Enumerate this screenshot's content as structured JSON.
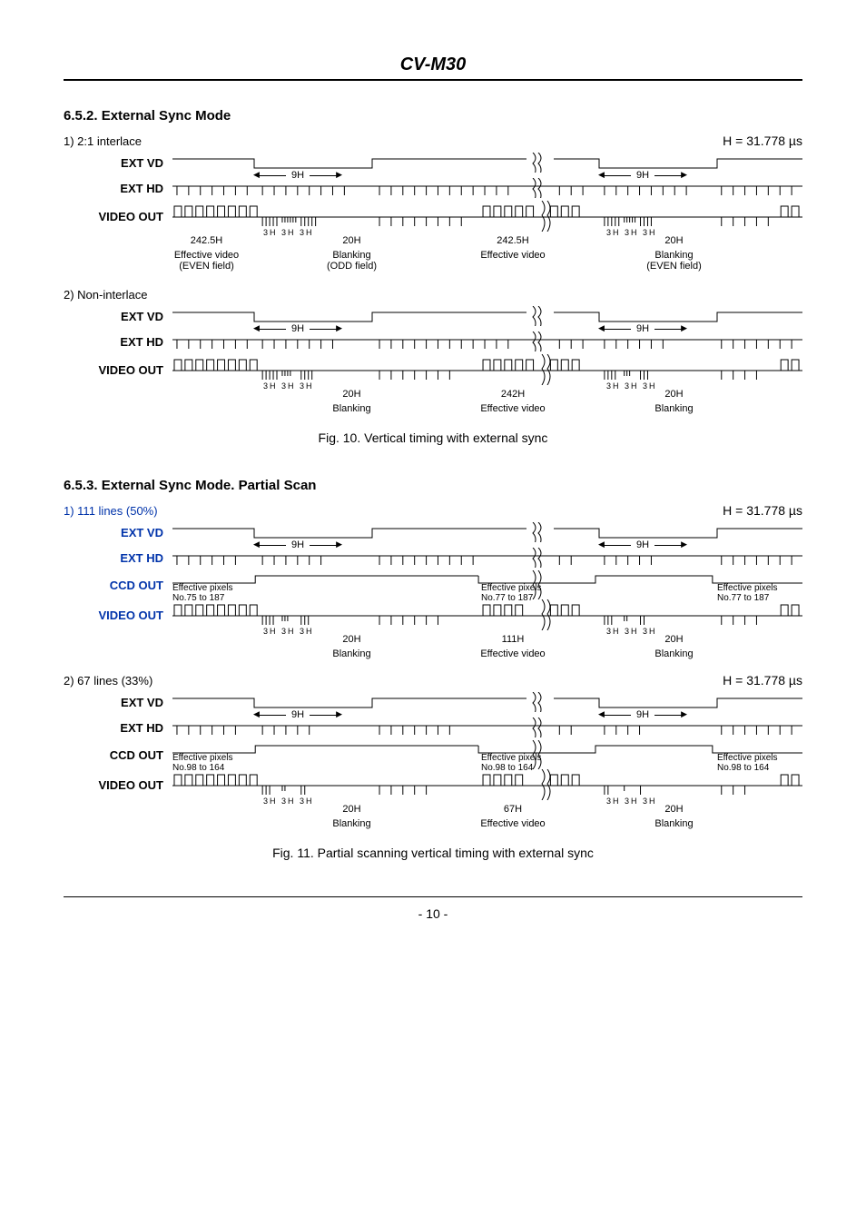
{
  "header": {
    "title": "CV-M30"
  },
  "sections": {
    "s652": "6.5.2. External Sync Mode",
    "s653": "6.5.3. External Sync Mode. Partial Scan"
  },
  "figures": {
    "fig10": "Fig. 10. Vertical timing with external sync",
    "fig11": "Fig. 11. Partial scanning vertical timing with external sync"
  },
  "hconst": "H = 31.778 µs",
  "fig10_panels": {
    "p1": {
      "title": "1) 2:1 interlace",
      "rows": [
        "EXT VD",
        "EXT HD",
        "VIDEO OUT"
      ],
      "dim9": "9H",
      "tiny": "3H   3H   3H",
      "annot": {
        "a1": "242.5H",
        "a1b": "Effective video\n(EVEN field)",
        "a2": "20H",
        "a2b": "Blanking\n(ODD field)",
        "a3": "242.5H",
        "a3b": "Effective video",
        "a4": "20H",
        "a4b": "Blanking\n(EVEN field)"
      }
    },
    "p2": {
      "title": "2) Non-interlace",
      "rows": [
        "EXT VD",
        "EXT HD",
        "VIDEO OUT"
      ],
      "dim9": "9H",
      "tiny": "3H   3H   3H",
      "annot": {
        "a2": "20H",
        "a2b": "Blanking",
        "a3": "242H",
        "a3b": "Effective video",
        "a4": "20H",
        "a4b": "Blanking"
      }
    }
  },
  "fig11_panels": {
    "p1": {
      "title": "1) 111 lines (50%)",
      "rows": [
        "EXT VD",
        "EXT HD",
        "CCD OUT",
        "VIDEO OUT"
      ],
      "dim9": "9H",
      "tiny": "3H   3H   3H",
      "ccd": {
        "c1": "Effective pixels\nNo.75 to 187",
        "c2": "Effective pixels\nNo.77 to 187",
        "c3": "Effective pixels\nNo.77 to 187"
      },
      "annot": {
        "a2": "20H",
        "a2b": "Blanking",
        "a3": "111H",
        "a3b": "Effective video",
        "a4": "20H",
        "a4b": "Blanking"
      }
    },
    "p2": {
      "title": "2) 67 lines (33%)",
      "rows": [
        "EXT VD",
        "EXT HD",
        "CCD OUT",
        "VIDEO OUT"
      ],
      "dim9": "9H",
      "tiny": "3H   3H   3H",
      "ccd": {
        "c1": "Effective pixels\nNo.98 to 164",
        "c2": "Effective pixels\nNo.98 to 164",
        "c3": "Effective pixels\nNo.98 to 164"
      },
      "annot": {
        "a2": "20H",
        "a2b": "Blanking",
        "a3": "67H",
        "a3b": "Effective video",
        "a4": "20H",
        "a4b": "Blanking"
      }
    }
  },
  "pagenum": "- 10 -"
}
